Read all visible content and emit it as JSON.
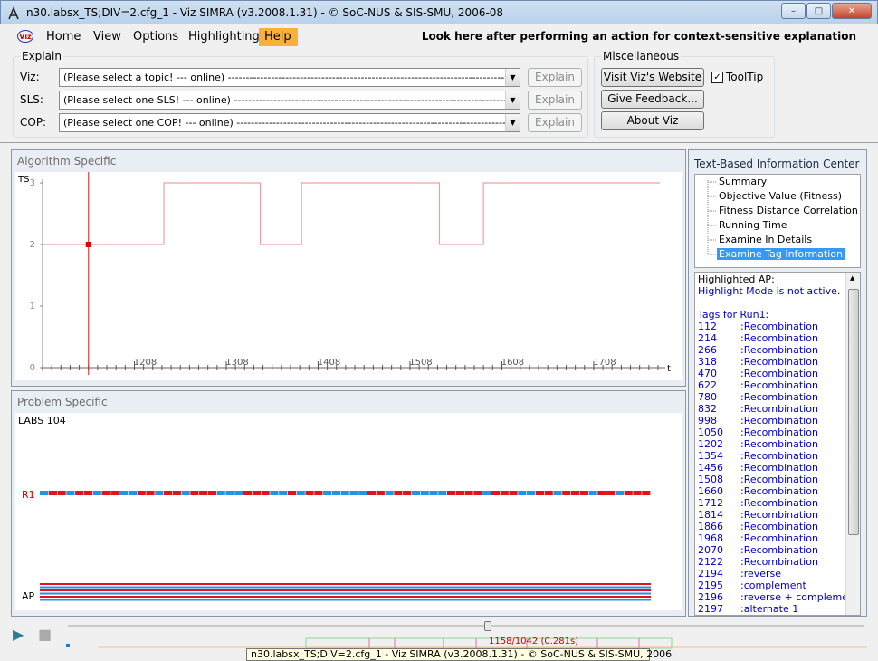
{
  "window": {
    "title": "n30.labsx_TS;DIV=2.cfg_1 - Viz SIMRA (v3.2008.1.31) - © SoC-NUS & SIS-SMU, 2006-08",
    "minimize_glyph": "–",
    "maximize_glyph": "□",
    "close_glyph": "✕"
  },
  "menu": {
    "logo_text": "Viz",
    "items": [
      "Home",
      "View",
      "Options",
      "Highlighting",
      "Help"
    ],
    "context_hint": "Look here after performing an action for context-sensitive explanation"
  },
  "explain": {
    "group_label": "Explain",
    "rows": [
      {
        "label": "Viz:",
        "value": "(Please select a topic! --- online) -----------------------------------------------------------------------------",
        "button": "Explain"
      },
      {
        "label": "SLS:",
        "value": "(Please select one SLS! --- online) ----------------------------------------------------------------------------",
        "button": "Explain"
      },
      {
        "label": "COP:",
        "value": "(Please select one COP! --- online) ---------------------------------------------------------------------------",
        "button": "Explain"
      }
    ]
  },
  "misc": {
    "group_label": "Miscellaneous",
    "website_button": "Visit Viz's Website",
    "feedback_button": "Give Feedback...",
    "about_button": "About Viz",
    "tooltip_label": "ToolTip",
    "tooltip_checked": true
  },
  "algorithm_panel": {
    "title": "Algorithm Specific",
    "y_label": "TS",
    "x_label": "t",
    "y_ticks": [
      "0",
      "1",
      "2",
      "3"
    ],
    "x_ticks": [
      "1208",
      "1308",
      "1408",
      "1508",
      "1608",
      "1708"
    ]
  },
  "chart_data": {
    "type": "line",
    "title": "",
    "xlabel": "t",
    "ylabel": "TS",
    "xlim": [
      1108,
      1780
    ],
    "ylim": [
      0,
      3
    ],
    "x": [
      1108,
      1240,
      1240,
      1345,
      1345,
      1390,
      1390,
      1540,
      1540,
      1588,
      1588,
      1780
    ],
    "y": [
      2,
      2,
      3,
      3,
      2,
      2,
      3,
      3,
      2,
      2,
      3,
      3
    ],
    "marker": {
      "x": 1158,
      "y": 2
    },
    "color": "#f2a0a0"
  },
  "problem_panel": {
    "title": "Problem Specific",
    "instance_label": "LABS 104",
    "r1_label": "R1",
    "ap_label": "AP",
    "r1_pattern": "BRRBRRBRRBBRRBRRBRRRBBBRRRBBRBRRBBBBBRRBRRBBBBRRRRBRRRBBRRBRRRBRRBRRR",
    "ap_rows": [
      "RRRRRRRRRRRRRRRRRRRRRRRRRRRRRRRRRRRRRRRRRRRRRRRRRRRRRRRRRRRRRRRR",
      "BBBBBBBBBBBBBBBBBBBBBBBBBBBBBBBBBBBBBBBBBBBBBBBBBBBBBBBBBBBBBBBB",
      "RRRRRRRRRRRRRRRRRRRRRRRRRRRRRRRRRRRRRRRRRRRRRRRRRRRRRRRRRRRRRRRR",
      "BBBBBBBBBBBBBBBBBBBBBBBBBBBBBBBBBBBBBBBBBBBBBBBBBBBBBBBBBBBBBBBB",
      "RRRRRRRRRRRRRRRRRRRRRRRRRRRRRRRRRRRRRRRRRRRRRRRRRRRRRRRRRRRRRRRR",
      "BBBBBBBBBBBBBBBBBBBBBBBBBBBBBBBBBBBBBBBBBBBBBBBBBBBBBBBBBBBBBBBB"
    ],
    "colors": {
      "red": "#e0141e",
      "blue": "#2196e0"
    }
  },
  "info_center": {
    "title": "Text-Based Information Center",
    "tree_items": [
      "Summary",
      "Objective Value (Fitness)",
      "Fitness Distance Correlation",
      "Running Time",
      "Examine In Details",
      "Examine Tag Information"
    ],
    "highlighted_ap": "Highlighted AP:",
    "highlight_mode": "Highlight Mode is not active.",
    "tags_header": "Tags for Run1:",
    "tags": [
      {
        "id": "112",
        "label": ":Recombination"
      },
      {
        "id": "214",
        "label": ":Recombination"
      },
      {
        "id": "266",
        "label": ":Recombination"
      },
      {
        "id": "318",
        "label": ":Recombination"
      },
      {
        "id": "470",
        "label": ":Recombination"
      },
      {
        "id": "622",
        "label": ":Recombination"
      },
      {
        "id": "780",
        "label": ":Recombination"
      },
      {
        "id": "832",
        "label": ":Recombination"
      },
      {
        "id": "998",
        "label": ":Recombination"
      },
      {
        "id": "1050",
        "label": ":Recombination"
      },
      {
        "id": "1202",
        "label": ":Recombination"
      },
      {
        "id": "1354",
        "label": ":Recombination"
      },
      {
        "id": "1456",
        "label": ":Recombination"
      },
      {
        "id": "1508",
        "label": ":Recombination"
      },
      {
        "id": "1660",
        "label": ":Recombination"
      },
      {
        "id": "1712",
        "label": ":Recombination"
      },
      {
        "id": "1814",
        "label": ":Recombination"
      },
      {
        "id": "1866",
        "label": ":Recombination"
      },
      {
        "id": "1968",
        "label": ":Recombination"
      },
      {
        "id": "2070",
        "label": ":Recombination"
      },
      {
        "id": "2122",
        "label": ":Recombination"
      },
      {
        "id": "2194",
        "label": ":reverse"
      },
      {
        "id": "2195",
        "label": ":complement"
      },
      {
        "id": "2196",
        "label": ":reverse + complement"
      },
      {
        "id": "2197",
        "label": ":alternate 1"
      }
    ]
  },
  "player": {
    "play_glyph": "▶",
    "stop_glyph": "■",
    "progress_text": "1158/1042 (0.281s)"
  },
  "taskbar_tip": "n30.labsx_TS;DIV=2.cfg_1 - Viz SIMRA (v3.2008.1.31) - © SoC-NUS & SIS-SMU, 2006"
}
